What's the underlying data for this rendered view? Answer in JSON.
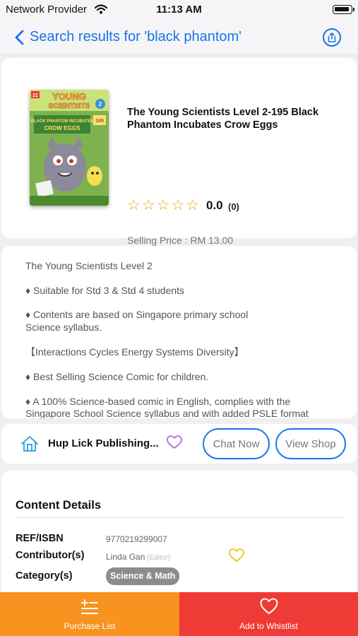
{
  "status_bar": {
    "carrier": "Network Provider",
    "time": "11:13 AM"
  },
  "nav": {
    "title": "Search results for 'black phantom'"
  },
  "product": {
    "title": "The Young Scientists Level 2-195 Black Phantom Incubates Crow Eggs",
    "rating_stars_filled": 0,
    "rating_stars_total": 5,
    "rating": "0.0",
    "rating_count": "(0)",
    "price": "Selling Price : RM 13.00",
    "cover": {
      "badge_number": "21",
      "brand_line1": "YOUNG",
      "brand_line2": "SCIENTISTS",
      "level": "2",
      "story_line1": "BLACK PHANTOM INCUBATES",
      "story_line2": "CROW EGGS",
      "issue": "195"
    }
  },
  "description": {
    "lines": [
      "The Young Scientists Level 2",
      "♦ Suitable for Std 3 & Std 4 students",
      "♦ Contents are based on Singapore primary school",
      "Science syllabus.",
      "【Interactions Cycles Energy Systems Diversity】",
      "♦ Best Selling Science Comic for children.",
      "♦ A 100% Science-based comic in English, complies with the",
      "Singapore School Science syllabus and with added PSLE format"
    ]
  },
  "shop": {
    "name": "Hup Lick Publishing...",
    "chat_label": "Chat Now",
    "view_label": "View Shop"
  },
  "details": {
    "heading": "Content Details",
    "isbn_label": "REF/ISBN",
    "isbn_value": "9770219299007",
    "contributor_label": "Contributor(s)",
    "contributor_name": "Linda Gan",
    "contributor_role": "(Editor)",
    "category_label": "Category(s)",
    "category_value": "Science & Math"
  },
  "bottom_bar": {
    "purchase_label": "Purchase List",
    "wish_label": "Add to Whistlist"
  },
  "colors": {
    "accent": "#1a73e8",
    "purchase_tab": "#f7931e",
    "wish_tab": "#ef3b36",
    "star": "#e8a317",
    "heart_purple": "#b068e6",
    "heart_gold": "#f0c419"
  }
}
